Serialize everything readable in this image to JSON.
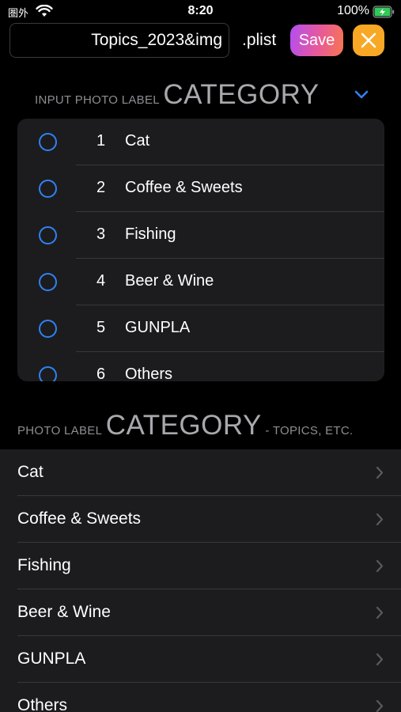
{
  "status_bar": {
    "carrier": "圏外",
    "time": "8:20",
    "battery": "100%"
  },
  "toolbar": {
    "filename_value": "Topics_2023&img",
    "extension": ".plist",
    "save_label": "Save"
  },
  "input_section": {
    "prefix": "INPUT PHOTO LABEL",
    "title": "CATEGORY",
    "items": [
      {
        "num": "1",
        "label": "Cat"
      },
      {
        "num": "2",
        "label": "Coffee & Sweets"
      },
      {
        "num": "3",
        "label": "Fishing"
      },
      {
        "num": "4",
        "label": "Beer & Wine"
      },
      {
        "num": "5",
        "label": "GUNPLA"
      },
      {
        "num": "6",
        "label": "Others"
      }
    ]
  },
  "list_section": {
    "prefix": "PHOTO LABEL",
    "title": "CATEGORY",
    "suffix": "- TOPICS, ETC.",
    "items": [
      {
        "label": "Cat"
      },
      {
        "label": "Coffee & Sweets"
      },
      {
        "label": "Fishing"
      },
      {
        "label": "Beer & Wine"
      },
      {
        "label": "GUNPLA"
      },
      {
        "label": "Others"
      }
    ]
  },
  "colors": {
    "accent_blue": "#2f82f5",
    "close_orange": "#f9a825",
    "save_gradient_start": "#b24ef3",
    "save_gradient_end": "#f7764f"
  },
  "icons": {
    "wifi": "wifi-icon",
    "battery": "battery-charging-icon",
    "close": "close-icon",
    "collapse": "chevron-down-icon",
    "row_disclosure": "chevron-right-icon",
    "radio": "radio-circle-icon"
  }
}
